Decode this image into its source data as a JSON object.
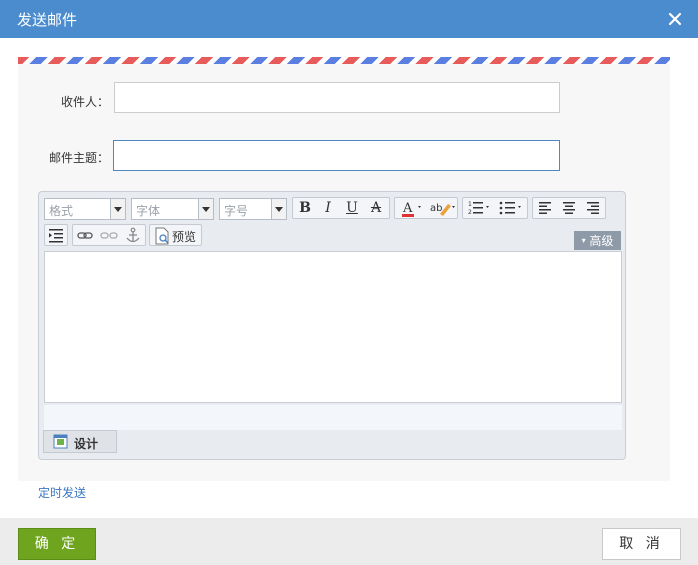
{
  "dialog": {
    "title": "发送邮件"
  },
  "form": {
    "to_label": "收件人：",
    "to_value": "",
    "subject_label": "邮件主题：",
    "subject_value": ""
  },
  "editor": {
    "format_combo": "格式",
    "font_combo": "字体",
    "size_combo": "字号",
    "preview_label": "预览",
    "advanced_label": "高级",
    "design_tab": "设计"
  },
  "schedule_link": "定时发送",
  "footer": {
    "ok": "确 定",
    "cancel": "取 消"
  },
  "colors": {
    "titlebar": "#4a8ccd",
    "ok_button": "#6fa41f",
    "link": "#3a78c2"
  }
}
